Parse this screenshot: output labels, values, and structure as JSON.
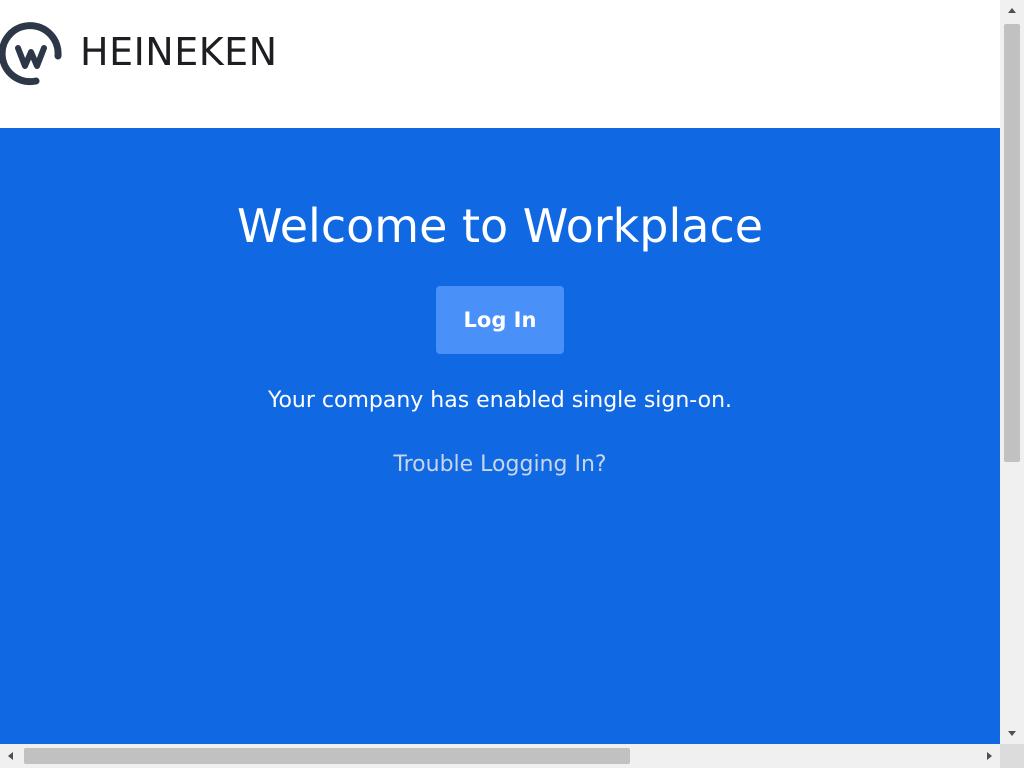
{
  "header": {
    "logo_icon": "workplace-logo-icon",
    "company_name": "HEINEKEN"
  },
  "hero": {
    "title": "Welcome to Workplace",
    "login_label": "Log In",
    "sso_message": "Your company has enabled single sign-on.",
    "trouble_link": "Trouble Logging In?"
  },
  "colors": {
    "hero_background": "#1069e2",
    "login_button": "#4a90f9",
    "link_text": "#c8d6ea",
    "logo": "#2d3748"
  },
  "scrollbars": {
    "vertical": {
      "position": 0.0,
      "visible_fraction": 0.59
    },
    "horizontal": {
      "position": 0.0,
      "visible_fraction": 0.63
    }
  }
}
